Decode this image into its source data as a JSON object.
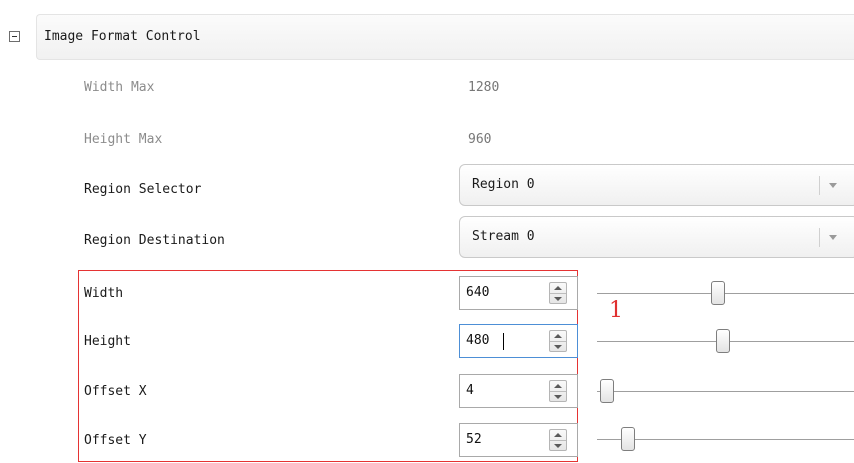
{
  "category": {
    "title": "Image Format Control"
  },
  "readonly": [
    {
      "label": "Width Max",
      "value": "1280"
    },
    {
      "label": "Height Max",
      "value": "960"
    }
  ],
  "selects": [
    {
      "label": "Region Selector",
      "selected": "Region 0"
    },
    {
      "label": "Region Destination",
      "selected": "Stream 0"
    }
  ],
  "numeric": [
    {
      "label": "Width",
      "value": "640",
      "slider_fraction": 0.47
    },
    {
      "label": "Height",
      "value": "480",
      "slider_fraction": 0.49
    },
    {
      "label": "Offset X",
      "value": "4",
      "slider_fraction": 0.0
    },
    {
      "label": "Offset Y",
      "value": "52",
      "slider_fraction": 0.09
    }
  ],
  "annotation": {
    "text": "1"
  },
  "colors": {
    "highlight": "#e53333",
    "annotation": "#e03030",
    "focus": "#4d8fd6"
  },
  "icons": {
    "collapse": "minus-box-icon",
    "dropdown": "chevron-down-icon",
    "spinner": "up-down-spinner-icon"
  }
}
